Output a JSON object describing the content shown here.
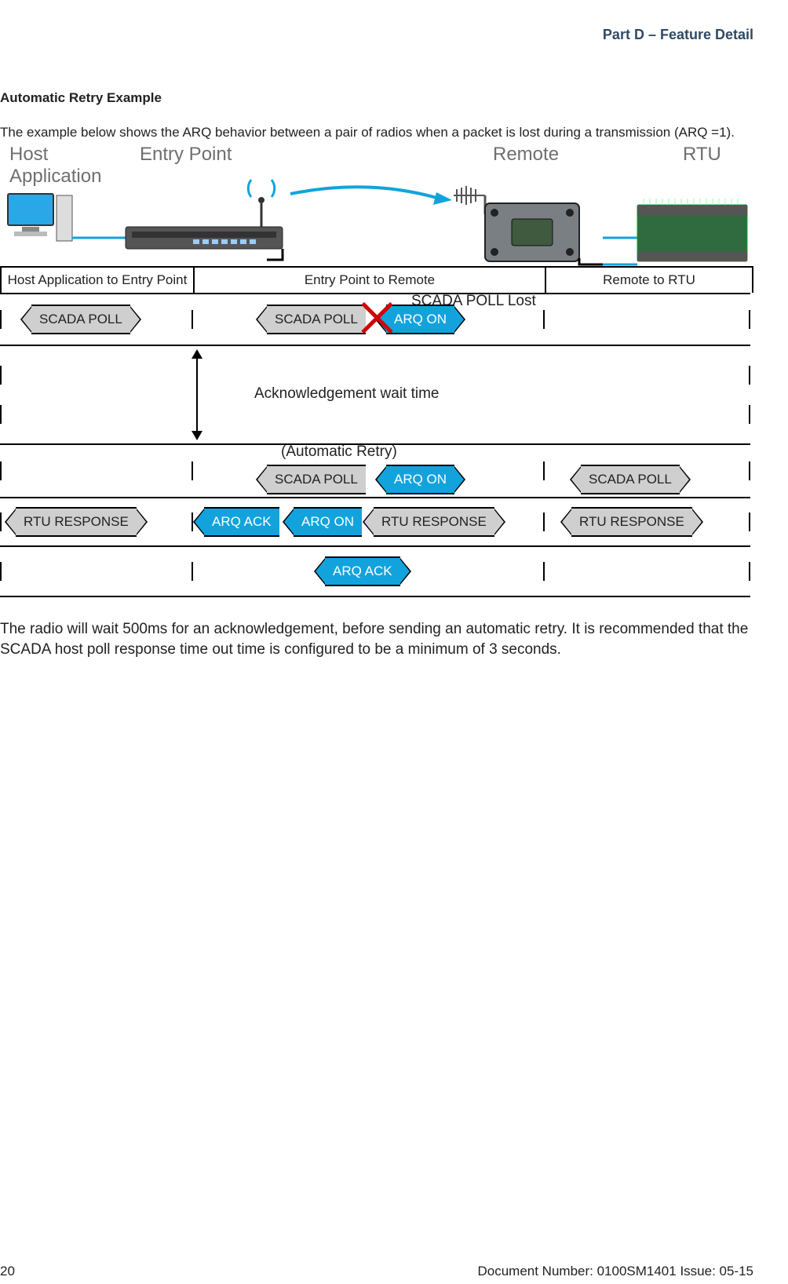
{
  "header": {
    "section": "Part D – Feature Detail"
  },
  "title": "Automatic Retry Example",
  "intro": "The example below shows the ARQ behavior between a pair of radios when a packet is lost during a transmission (ARQ =1).",
  "devices": {
    "host": "Host\nApplication",
    "entry": "Entry Point",
    "remote": "Remote",
    "rtu": "RTU"
  },
  "columns": {
    "c1": "Host Application to Entry Point",
    "c2": "Entry Point to Remote",
    "c3": "Remote to RTU"
  },
  "annotations": {
    "lost": "SCADA POLL Lost",
    "ack_wait": "Acknowledgement wait time",
    "auto_retry": "(Automatic Retry)"
  },
  "tags": {
    "scada_poll": "SCADA POLL",
    "arq_on": "ARQ ON",
    "rtu_response": "RTU RESPONSE",
    "arq_ack": "ARQ ACK"
  },
  "closing": "The radio will wait 500ms for an acknowledgement, before sending an automatic retry. It is recommended that the SCADA host poll response time out time is configured to be a minimum of 3 seconds.",
  "footer": {
    "page": "20",
    "doc": "Document Number: 0100SM1401   Issue: 05-15"
  }
}
